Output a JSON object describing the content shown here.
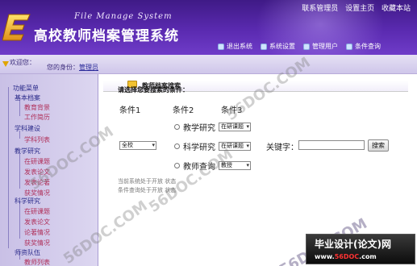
{
  "header": {
    "system_name_en": "File Manage System",
    "system_name_cn": "高校教师档案管理系统",
    "links": [
      "联系管理员",
      "设置主页",
      "收藏本站"
    ],
    "toolbar": [
      "退出系统",
      "系统设置",
      "管理用户",
      "条件查询"
    ]
  },
  "subbar": {
    "welcome": "欢迎您：",
    "identity_label": "您的身份：",
    "identity_value": "管理员"
  },
  "sidebar": {
    "root": "功能菜单",
    "groups": [
      {
        "label": "基本档案",
        "items": [
          "教育背景",
          "工作简历"
        ]
      },
      {
        "label": "学科建设",
        "items": [
          "学科列表"
        ]
      },
      {
        "label": "教学研究",
        "items": [
          "在研课题",
          "发表论文",
          "发表论著",
          "获奖情况"
        ]
      },
      {
        "label": "科学研究",
        "items": [
          "在研课题",
          "发表论文",
          "论著情况",
          "获奖情况"
        ]
      },
      {
        "label": "师资队伍",
        "items": [
          "教师列表"
        ]
      }
    ]
  },
  "main": {
    "title": "教师档案搜索",
    "prompt": "请选择您要搜索的条件：",
    "headers": [
      "条件1",
      "条件2",
      "条件3"
    ],
    "cond1_value": "全校",
    "rows": [
      {
        "radio_label": "教学研究",
        "select": "在研课题"
      },
      {
        "radio_label": "科学研究",
        "select": "在研课题"
      },
      {
        "radio_label": "教师查询",
        "select": "教授"
      }
    ],
    "keyword_label": "关键字：",
    "search_button": "搜索",
    "status1": "当前系统处于开放  状态",
    "status2": "条件查询处于开放  状态"
  },
  "watermarks": [
    "56DOC.COM",
    "56DOC.COM",
    "56DOC.COM",
    "56DOC.COM",
    "56DOC.COM"
  ],
  "badge": {
    "title": "毕业设计(论文)网",
    "url_prefix": "www.",
    "url_brand": "56DOC",
    "url_suffix": ".com"
  },
  "colors": {
    "header_purple": "#5a2ab0",
    "sidebar_lavender": "#d6cfee",
    "badge_red": "#ff3333"
  }
}
